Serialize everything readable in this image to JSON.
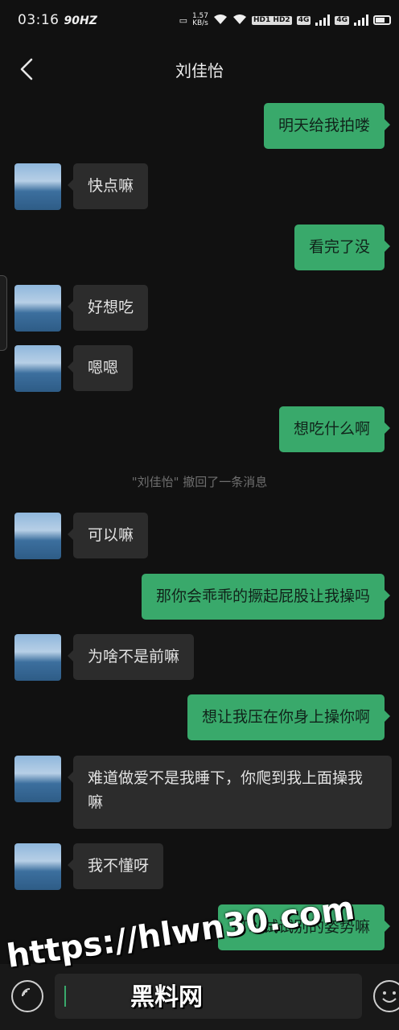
{
  "status_bar": {
    "time": "03:16",
    "refresh": "90HZ",
    "speed_value": "1.57",
    "speed_unit": "KB/s",
    "hd_label": "HD1 HD2",
    "network": "4G",
    "network2": "4G"
  },
  "header": {
    "title": "刘佳怡"
  },
  "messages": [
    {
      "side": "out",
      "text": "明天给我拍喽"
    },
    {
      "side": "in",
      "text": "快点嘛"
    },
    {
      "side": "out",
      "text": "看完了没"
    },
    {
      "side": "in",
      "text": "好想吃"
    },
    {
      "side": "in",
      "text": "嗯嗯"
    },
    {
      "side": "out",
      "text": "想吃什么啊"
    },
    {
      "side": "in",
      "text": "可以嘛"
    },
    {
      "side": "out",
      "text": "那你会乖乖的撅起屁股让我操吗"
    },
    {
      "side": "in",
      "text": "为啥不是前嘛"
    },
    {
      "side": "out",
      "text": "想让我压在你身上操你啊"
    },
    {
      "side": "in",
      "text": "难道做爱不是我睡下，你爬到我上面操我嘛"
    },
    {
      "side": "in",
      "text": "我不懂呀"
    },
    {
      "side": "out",
      "text": "可以试试别的姿势嘛"
    }
  ],
  "system_note": "\"刘佳怡\" 撤回了一条消息",
  "input": {
    "value": ""
  },
  "watermark": {
    "url": "https://hlwn30.com",
    "brand": "黑料网"
  },
  "colors": {
    "background": "#111111",
    "outgoing_bubble": "#39a96b",
    "incoming_bubble": "#2c2c2c"
  }
}
